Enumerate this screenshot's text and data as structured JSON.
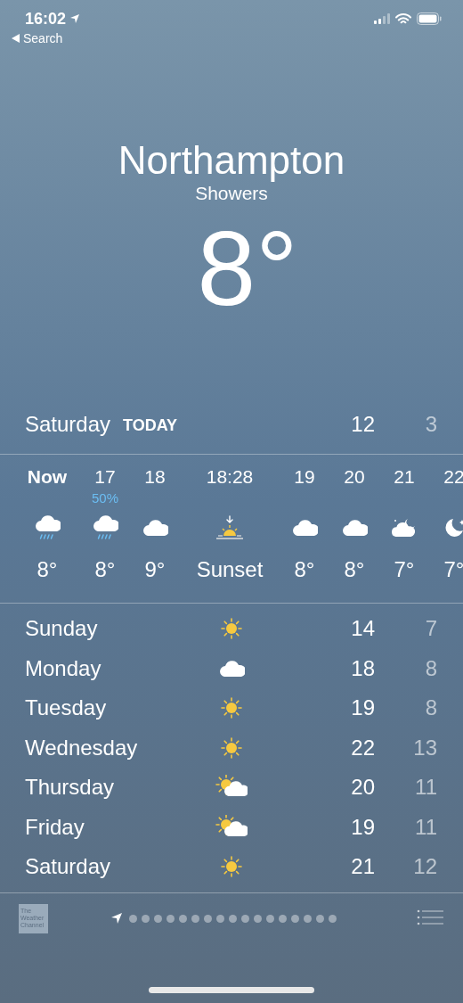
{
  "status_bar": {
    "time": "16:02",
    "back_label": "Search"
  },
  "location": {
    "city": "Northampton",
    "condition": "Showers",
    "temperature": "8°"
  },
  "today": {
    "day": "Saturday",
    "label": "TODAY",
    "high": "12",
    "low": "3"
  },
  "hourly": [
    {
      "time": "Now",
      "selected": true,
      "kind": "rain",
      "temp": "8°"
    },
    {
      "time": "17",
      "selected": false,
      "kind": "rain",
      "chance": "50%",
      "temp": "8°"
    },
    {
      "time": "18",
      "selected": false,
      "kind": "cloud",
      "temp": "9°"
    },
    {
      "time": "18:28",
      "selected": false,
      "kind": "sunset",
      "temp": "Sunset"
    },
    {
      "time": "19",
      "selected": false,
      "kind": "cloud",
      "temp": "8°"
    },
    {
      "time": "20",
      "selected": false,
      "kind": "cloud",
      "temp": "8°"
    },
    {
      "time": "21",
      "selected": false,
      "kind": "night-cloud",
      "temp": "7°"
    },
    {
      "time": "22",
      "selected": false,
      "kind": "moon",
      "temp": "7°"
    }
  ],
  "daily": [
    {
      "day": "Sunday",
      "kind": "sun",
      "high": "14",
      "low": "7"
    },
    {
      "day": "Monday",
      "kind": "cloud",
      "high": "18",
      "low": "8"
    },
    {
      "day": "Tuesday",
      "kind": "sun",
      "high": "19",
      "low": "8"
    },
    {
      "day": "Wednesday",
      "kind": "sun",
      "high": "22",
      "low": "13"
    },
    {
      "day": "Thursday",
      "kind": "sun-cloud",
      "high": "20",
      "low": "11"
    },
    {
      "day": "Friday",
      "kind": "sun-cloud",
      "high": "19",
      "low": "11"
    },
    {
      "day": "Saturday",
      "kind": "sun",
      "high": "21",
      "low": "12"
    }
  ],
  "footer": {
    "logo_lines": [
      "The",
      "Weather",
      "Channel"
    ],
    "pages": [
      {
        "kind": "location",
        "selected": true
      },
      {
        "kind": "dot",
        "selected": false
      },
      {
        "kind": "dot",
        "selected": false
      },
      {
        "kind": "dot",
        "selected": false
      },
      {
        "kind": "dot",
        "selected": false
      },
      {
        "kind": "dot",
        "selected": false
      },
      {
        "kind": "dot",
        "selected": false
      },
      {
        "kind": "dot",
        "selected": false
      },
      {
        "kind": "dot",
        "selected": false
      },
      {
        "kind": "dot",
        "selected": false
      },
      {
        "kind": "dot",
        "selected": false
      },
      {
        "kind": "dot",
        "selected": false
      },
      {
        "kind": "dot",
        "selected": false
      },
      {
        "kind": "dot",
        "selected": false
      },
      {
        "kind": "dot",
        "selected": false
      },
      {
        "kind": "dot",
        "selected": false
      },
      {
        "kind": "dot",
        "selected": false
      },
      {
        "kind": "dot",
        "selected": false
      }
    ]
  }
}
